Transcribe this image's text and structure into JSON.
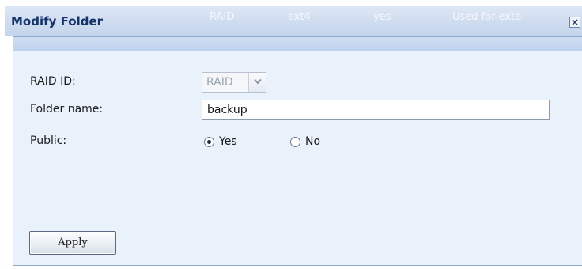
{
  "window": {
    "title": "Modify Folder",
    "close_label": "×"
  },
  "background_row": {
    "cells": [
      "RAID",
      "ext4",
      "yes",
      "Used for exte"
    ]
  },
  "form": {
    "raid_id_label": "RAID ID:",
    "raid_id_value": "RAID",
    "folder_name_label": "Folder name:",
    "folder_name_value": "backup",
    "public_label": "Public:",
    "public_options": [
      {
        "label": "Yes",
        "checked": true
      },
      {
        "label": "No",
        "checked": false
      }
    ]
  },
  "actions": {
    "apply_label": "Apply"
  },
  "icons": {
    "dropdown": "chevron-down-icon",
    "close": "close-icon"
  },
  "colors": {
    "title_text": "#15336b",
    "panel_bg": "#e9f1fb",
    "titlebar_bg": "#cfdcef"
  }
}
